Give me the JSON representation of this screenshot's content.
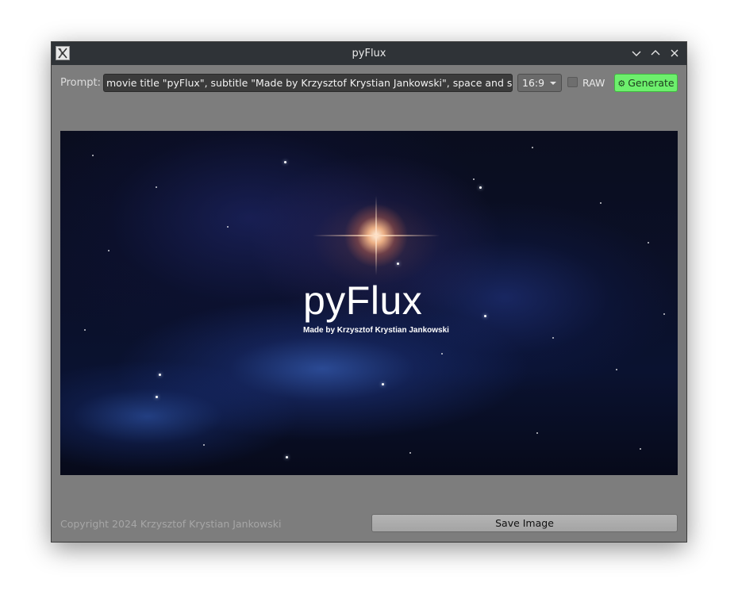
{
  "window": {
    "title": "pyFlux"
  },
  "toolbar": {
    "prompt_label": "Prompt:",
    "prompt_value": "movie title \"pyFlux\", subtitle \"Made by Krzysztof Krystian Jankowski\",  space and star",
    "aspect_ratio": "16:9",
    "raw_label": "RAW",
    "raw_checked": false,
    "generate_label": "Generate",
    "generate_color": "#6df06d"
  },
  "image": {
    "title_text": "pyFlux",
    "subtitle_text": "Made by Krzysztof Krystian Jankowski"
  },
  "footer": {
    "copyright": "Copyright 2024 Krzysztof Krystian Jankowski",
    "save_label": "Save Image"
  },
  "icons": {
    "app": "app-icon",
    "minimize": "chevron-down-icon",
    "maximize": "chevron-up-icon",
    "close": "close-icon",
    "generate": "gear-icon"
  }
}
